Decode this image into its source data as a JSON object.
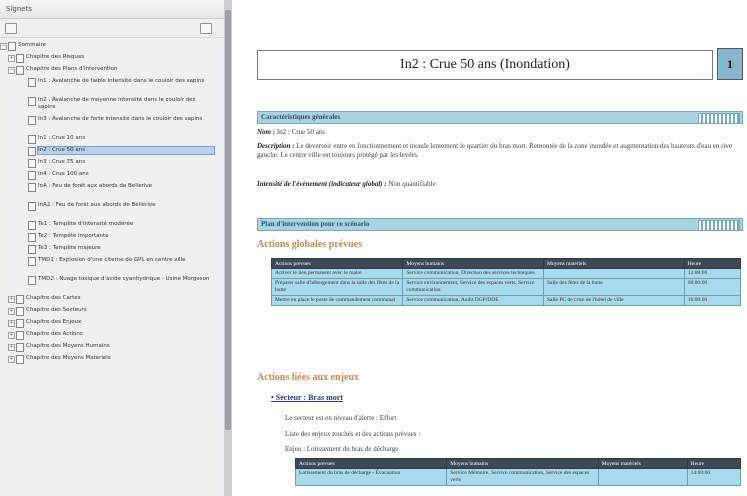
{
  "panel": {
    "title": "Signets",
    "tree": [
      {
        "level": 0,
        "expander": "−",
        "label": "Sommaire"
      },
      {
        "level": 1,
        "expander": "+",
        "label": "Chapitre des Risques"
      },
      {
        "level": 1,
        "expander": "−",
        "label": "Chapitre des Plans d'Intervention"
      },
      {
        "level": 2,
        "expander": "",
        "label": "In1 : Avalanche de faible intensité dans le couloir des sapins"
      },
      {
        "level": 2,
        "expander": "",
        "label": "In2 : Avalanche de moyenne intensité dans le couloir des sapins"
      },
      {
        "level": 2,
        "expander": "",
        "label": "In3 : Avalanche de forte intensité dans le couloir des sapins"
      },
      {
        "level": 2,
        "expander": "",
        "label": "In1 : Crue 10 ans"
      },
      {
        "level": 2,
        "expander": "",
        "label": "In2 : Crue 50 ans",
        "selected": true
      },
      {
        "level": 2,
        "expander": "",
        "label": "In3 : Crue 75 ans"
      },
      {
        "level": 2,
        "expander": "",
        "label": "In4 : Crue 100 ans"
      },
      {
        "level": 2,
        "expander": "",
        "label": "InA : Feu de forêt aux abords de Bellerive"
      },
      {
        "level": 2,
        "expander": "",
        "label": "InA2 : Feu de forêt aux abords de Bellerive"
      },
      {
        "level": 2,
        "expander": "",
        "label": "Te1 : Tempête d'intensité modérée"
      },
      {
        "level": 2,
        "expander": "",
        "label": "Te2 : Tempête importante"
      },
      {
        "level": 2,
        "expander": "",
        "label": "Te3 : Tempête majeure"
      },
      {
        "level": 2,
        "expander": "",
        "label": "TMD1 : Explosion d'une citerne de GPL en centre ville"
      },
      {
        "level": 2,
        "expander": "",
        "label": "TMD2 : Nuage toxique d'acide cyanhydrique - Usine Morgeson"
      },
      {
        "level": 1,
        "expander": "+",
        "label": "Chapitre des Cartes"
      },
      {
        "level": 1,
        "expander": "+",
        "label": "Chapitre des Secteurs"
      },
      {
        "level": 1,
        "expander": "+",
        "label": "Chapitre des Enjeux"
      },
      {
        "level": 1,
        "expander": "+",
        "label": "Chapitre des Actions"
      },
      {
        "level": 1,
        "expander": "+",
        "label": "Chapitre des Moyens Humains"
      },
      {
        "level": 1,
        "expander": "+",
        "label": "Chapitre des Moyens Matériels"
      }
    ]
  },
  "doc": {
    "title": "In2 : Crue 50 ans (Inondation)",
    "page_number": "1",
    "section1_title": "Caractéristiques générales",
    "name_label": "Nom :",
    "name_value": "In2 : Crue 50 ans",
    "desc_label": "Description :",
    "desc_value": "Le deversoir entre en fonctionnement et inonde lentement le quartier du bras mort. Remontée de la zone inondée et augmentation des hauteurs d'eau en rive gauche. Le centre ville est toujours protégé par les levées.",
    "intensity_label": "Intensité de l'évènement (indicateur global) :",
    "intensity_value": "Non quantifiable",
    "section2_title": "Plan d'intervention pour ce scénario",
    "global_actions_title": "Actions globales prévues",
    "global_table": {
      "headers": [
        "Actions prévues",
        "Moyens humains",
        "Moyens matériels",
        "Heure"
      ],
      "rows": [
        [
          "Activer le lieu permanent avec le maire",
          "Service communication, Direction des services techniques",
          "",
          "12:00:00"
        ],
        [
          "Préparer salle d'hébergement dans la salle des fêtes de la butte",
          "Service environnement, Service des espaces verts, Service communication",
          "Salle des fêtes de la butte",
          "08:00:00"
        ],
        [
          "Mettre en place le poste de commandement communal",
          "Service communication, Audit DGP/DDE",
          "Salle PC de crise de l'hôtel de ville",
          "16:00:00"
        ]
      ]
    },
    "linked_actions_title": "Actions liées aux enjeux",
    "sector_title": "• Secteur : Bras mort",
    "sector_alert": "Le secteur est en niveau d'alerte : Effort",
    "sector_list": "Liste des enjeux touchés et des actions prévues :",
    "issue": "Enjeu : Lotissement du bras de décharge",
    "issue_table": {
      "headers": [
        "Actions prévues",
        "Moyens humains",
        "Moyens matériels",
        "Heure"
      ],
      "rows": [
        [
          "Lotissement du bras de décharge - Évacuation",
          "Service Mémoire, Service communication, Service des espaces verts",
          "",
          "14:00:00"
        ]
      ]
    }
  },
  "colors": {
    "section_bar": "#a8d3e1",
    "table_header": "#3d4a55",
    "table_cell": "#a8d9ec",
    "orange_heading": "#c98a55",
    "page_box": "#86b7cc"
  }
}
